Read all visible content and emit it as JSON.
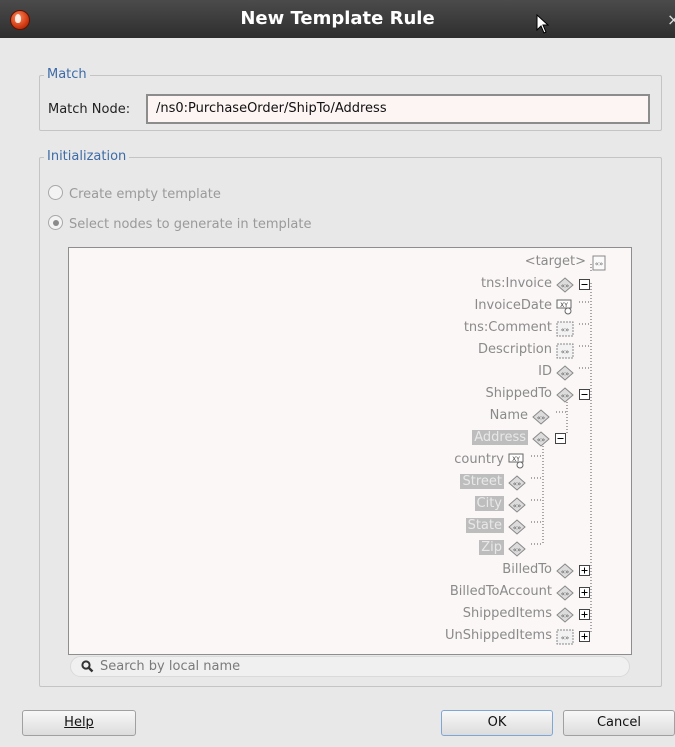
{
  "window": {
    "title": "New Template Rule"
  },
  "match": {
    "legend": "Match",
    "node_label": "Match Node:",
    "node_value": "/ns0:PurchaseOrder/ShipTo/Address"
  },
  "initialization": {
    "legend": "Initialization",
    "options": [
      {
        "label": "Create empty template",
        "selected": false
      },
      {
        "label": "Select nodes to generate in template",
        "selected": true
      }
    ]
  },
  "tree": [
    {
      "label": "<target>",
      "icon": "target-schema-icon",
      "highlighted": false
    },
    {
      "label": "tns:Invoice",
      "icon": "element-icon",
      "expander": "collapse",
      "highlighted": false
    },
    {
      "label": "InvoiceDate",
      "icon": "xy-attribute-icon",
      "highlighted": false
    },
    {
      "label": "tns:Comment",
      "icon": "optional-element-icon",
      "highlighted": false
    },
    {
      "label": "Description",
      "icon": "optional-element-icon",
      "highlighted": false
    },
    {
      "label": "ID",
      "icon": "element-icon",
      "highlighted": false
    },
    {
      "label": "ShippedTo",
      "icon": "element-icon",
      "expander": "collapse",
      "highlighted": false
    },
    {
      "label": "Name",
      "icon": "element-icon",
      "highlighted": false
    },
    {
      "label": "Address",
      "icon": "element-icon",
      "expander": "collapse",
      "highlighted": true
    },
    {
      "label": "country",
      "icon": "xy-attribute-icon",
      "highlighted": false
    },
    {
      "label": "Street",
      "icon": "element-icon",
      "highlighted": true
    },
    {
      "label": "City",
      "icon": "element-icon",
      "highlighted": true
    },
    {
      "label": "State",
      "icon": "element-icon",
      "highlighted": true
    },
    {
      "label": "Zip",
      "icon": "element-icon",
      "highlighted": true
    },
    {
      "label": "BilledTo",
      "icon": "element-icon",
      "expander": "expand",
      "highlighted": false
    },
    {
      "label": "BilledToAccount",
      "icon": "element-icon",
      "expander": "expand",
      "highlighted": false
    },
    {
      "label": "ShippedItems",
      "icon": "element-icon",
      "expander": "expand",
      "highlighted": false
    },
    {
      "label": "UnShippedItems",
      "icon": "optional-element-icon",
      "expander": "expand",
      "highlighted": false
    }
  ],
  "search": {
    "placeholder": "Search by local name"
  },
  "buttons": {
    "help": "Help",
    "ok": "OK",
    "cancel": "Cancel"
  }
}
